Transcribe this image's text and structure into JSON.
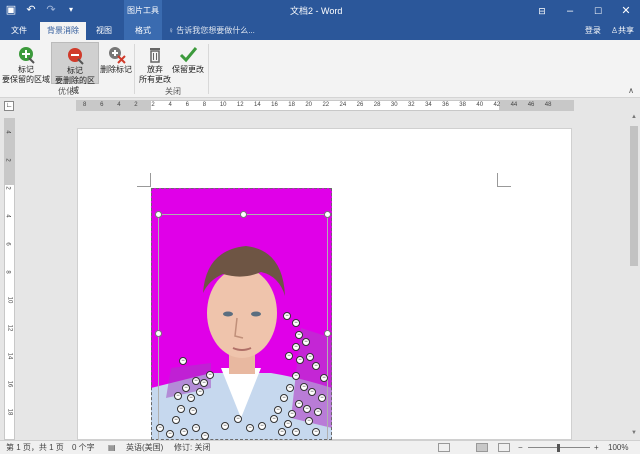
{
  "title": {
    "window_title": "文档2 - Word",
    "contextual_group": "图片工具"
  },
  "tabs": {
    "file": "文件",
    "background_removal": "背景消除",
    "view": "视图",
    "format": "格式",
    "tell_me": "告诉我您想要做什么..."
  },
  "account": {
    "sign_in": "登录",
    "share": "共享"
  },
  "ribbon": {
    "mark_keep_line1": "标记",
    "mark_keep_line2": "要保留的区域",
    "mark_remove_line1": "标记",
    "mark_remove_line2": "要删除的区域",
    "delete_mark": "删除标记",
    "discard_line1": "放弃",
    "discard_line2": "所有更改",
    "keep_changes": "保留更改",
    "group_refine": "优化",
    "group_close": "关闭"
  },
  "ruler": {
    "h_ticks": [
      "8",
      "6",
      "4",
      "2",
      "2",
      "4",
      "6",
      "8",
      "10",
      "12",
      "14",
      "16",
      "18",
      "20",
      "22",
      "24",
      "26",
      "28",
      "30",
      "32",
      "34",
      "36",
      "38",
      "40",
      "42",
      "44",
      "46",
      "48"
    ],
    "v_ticks": [
      "4",
      "2",
      "2",
      "4",
      "6",
      "8",
      "10",
      "12",
      "14",
      "16",
      "18"
    ]
  },
  "status": {
    "page": "第 1 页，共 1 页",
    "words": "0 个字",
    "language": "英语(美国)",
    "track_changes": "修订: 关闭",
    "zoom": "100%",
    "zoom_minus": "−",
    "zoom_plus": "+"
  },
  "colors": {
    "title_bar": "#2b579a",
    "removal_magenta": "#e000e8",
    "keep_green": "#3c9a3c",
    "remove_red": "#d03a2a"
  },
  "icons": {
    "save": "save-icon",
    "undo": "undo-icon",
    "redo": "redo-icon",
    "lightbulb": "lightbulb-icon",
    "user": "user-icon"
  }
}
